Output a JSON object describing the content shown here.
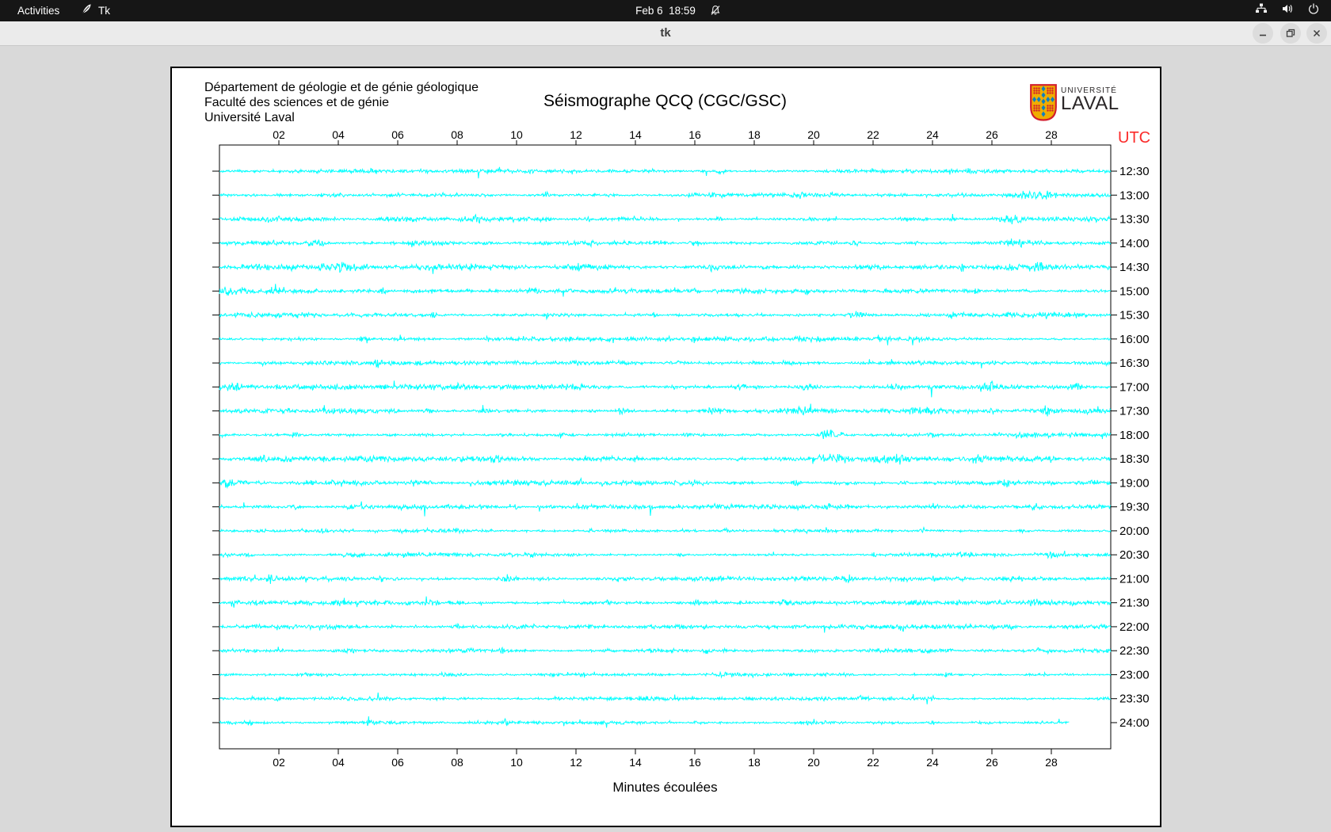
{
  "top_bar": {
    "activities": "Activities",
    "app_name": "Tk",
    "clock": "Feb 6  18:59"
  },
  "window": {
    "title": "tk"
  },
  "canvas": {
    "header_lines": [
      "Département de géologie et de génie géologique",
      "Faculté des sciences et de génie",
      "Université Laval"
    ],
    "title": "Séismographe QCQ (CGC/GSC)",
    "utc_label": "UTC",
    "x_axis_label": "Minutes écoulées",
    "logo": {
      "line1": "UNIVERSITÉ",
      "line2": "LAVAL"
    }
  },
  "colors": {
    "trace": "#00ffff",
    "axis": "#000000",
    "utc_red": "#fb2b2a",
    "canvas_bg": "#ffffff",
    "app_bg": "#d9d9d9"
  },
  "seismogram": {
    "type": "line",
    "x_ticks": [
      "02",
      "04",
      "06",
      "08",
      "10",
      "12",
      "14",
      "16",
      "18",
      "20",
      "22",
      "24",
      "26",
      "28"
    ],
    "x_range_minutes": [
      0,
      30
    ],
    "minutes_per_tick": 2,
    "traces": [
      {
        "utc": "12:30",
        "activity": 0.9,
        "end": 30,
        "events": [
          [
            5.2,
            5,
            0.08
          ],
          [
            9.4,
            4,
            0.06
          ],
          [
            13.1,
            3,
            0.06
          ],
          [
            16.9,
            5,
            0.1
          ],
          [
            20.4,
            3,
            0.06
          ],
          [
            25.3,
            6,
            0.12
          ],
          [
            28.9,
            3,
            0.1
          ]
        ]
      },
      {
        "utc": "13:00",
        "activity": 0.9,
        "end": 30,
        "events": [
          [
            3.4,
            3,
            0.08
          ],
          [
            11.0,
            4,
            0.08
          ],
          [
            16.5,
            3,
            0.06
          ],
          [
            19.6,
            3,
            0.06
          ],
          [
            23.0,
            3,
            0.08
          ],
          [
            27.6,
            6,
            0.45
          ]
        ]
      },
      {
        "utc": "13:30",
        "activity": 1.1,
        "end": 30,
        "events": [
          [
            1.6,
            4,
            0.1
          ],
          [
            6.2,
            4,
            0.55
          ],
          [
            8.6,
            4,
            0.1
          ],
          [
            12.4,
            4,
            0.08
          ],
          [
            16.8,
            3,
            0.08
          ],
          [
            19.9,
            4,
            0.1
          ],
          [
            23.0,
            3,
            0.1
          ],
          [
            26.6,
            5,
            0.3
          ]
        ]
      },
      {
        "utc": "14:00",
        "activity": 1.0,
        "end": 30,
        "events": [
          [
            3.3,
            5,
            0.2
          ],
          [
            6.5,
            3,
            0.1
          ],
          [
            9.0,
            4,
            0.1
          ],
          [
            12.5,
            3,
            0.08
          ],
          [
            16.0,
            4,
            0.1
          ],
          [
            21.4,
            4,
            0.1
          ],
          [
            24.3,
            3,
            0.08
          ],
          [
            26.9,
            6,
            0.22
          ]
        ]
      },
      {
        "utc": "14:30",
        "activity": 1.2,
        "end": 30,
        "events": [
          [
            1.2,
            3,
            0.1
          ],
          [
            4.1,
            5,
            0.3
          ],
          [
            8.0,
            3,
            0.1
          ],
          [
            12.2,
            5,
            0.5
          ],
          [
            16.6,
            4,
            0.2
          ],
          [
            19.5,
            3,
            0.1
          ],
          [
            22.0,
            4,
            0.2
          ],
          [
            25.0,
            3,
            0.1
          ],
          [
            27.6,
            5,
            0.2
          ]
        ]
      },
      {
        "utc": "15:00",
        "activity": 1.2,
        "end": 30,
        "events": [
          [
            0.5,
            6,
            0.35
          ],
          [
            1.7,
            5,
            0.2
          ],
          [
            5.5,
            3,
            0.1
          ],
          [
            10.6,
            4,
            0.15
          ],
          [
            13.4,
            3,
            0.1
          ],
          [
            16.0,
            4,
            0.1
          ],
          [
            19.8,
            3,
            0.1
          ],
          [
            22.5,
            3,
            0.1
          ],
          [
            25.4,
            4,
            0.15
          ]
        ]
      },
      {
        "utc": "15:30",
        "activity": 1.0,
        "end": 30,
        "events": [
          [
            2.0,
            3,
            0.1
          ],
          [
            7.2,
            3,
            0.08
          ],
          [
            11.0,
            3,
            0.08
          ],
          [
            14.6,
            4,
            0.1
          ],
          [
            18.2,
            3,
            0.08
          ],
          [
            21.4,
            6,
            0.15
          ],
          [
            24.6,
            4,
            0.1
          ],
          [
            27.8,
            4,
            0.1
          ]
        ]
      },
      {
        "utc": "16:00",
        "activity": 0.85,
        "end": 30,
        "events": [
          [
            4.8,
            4,
            0.1
          ],
          [
            9.0,
            3,
            0.06
          ],
          [
            16.0,
            3,
            0.08
          ],
          [
            20.2,
            3,
            0.06
          ],
          [
            23.5,
            4,
            0.1
          ]
        ]
      },
      {
        "utc": "16:30",
        "activity": 0.85,
        "end": 30,
        "events": [
          [
            1.5,
            3,
            0.08
          ],
          [
            5.3,
            6,
            0.1
          ],
          [
            12.0,
            3,
            0.08
          ],
          [
            15.5,
            3,
            0.06
          ],
          [
            19.0,
            3,
            0.08
          ],
          [
            22.6,
            3,
            0.06
          ],
          [
            26.0,
            3,
            0.08
          ]
        ]
      },
      {
        "utc": "17:00",
        "activity": 1.25,
        "end": 30,
        "events": [
          [
            0.4,
            6,
            0.3
          ],
          [
            3.8,
            4,
            0.15
          ],
          [
            8.0,
            3,
            0.1
          ],
          [
            12.0,
            3,
            0.1
          ],
          [
            15.2,
            3,
            0.1
          ],
          [
            17.5,
            4,
            0.15
          ],
          [
            19.8,
            5,
            0.2
          ],
          [
            22.8,
            4,
            0.15
          ],
          [
            25.9,
            6,
            0.3
          ],
          [
            28.8,
            4,
            0.2
          ]
        ]
      },
      {
        "utc": "17:30",
        "activity": 1.2,
        "end": 30,
        "events": [
          [
            0.8,
            4,
            0.1
          ],
          [
            3.5,
            6,
            0.12
          ],
          [
            7.0,
            3,
            0.1
          ],
          [
            10.5,
            3,
            0.1
          ],
          [
            13.5,
            4,
            0.1
          ],
          [
            16.5,
            3,
            0.1
          ],
          [
            19.5,
            4,
            0.28
          ],
          [
            23.5,
            5,
            0.3
          ],
          [
            26.0,
            4,
            0.15
          ],
          [
            27.9,
            7,
            0.14
          ]
        ]
      },
      {
        "utc": "18:00",
        "activity": 0.9,
        "end": 30,
        "events": [
          [
            2.5,
            3,
            0.1
          ],
          [
            7.0,
            3,
            0.08
          ],
          [
            11.5,
            3,
            0.08
          ],
          [
            15.8,
            3,
            0.1
          ],
          [
            20.5,
            6,
            0.3
          ],
          [
            24.0,
            3,
            0.1
          ],
          [
            27.0,
            3,
            0.1
          ]
        ]
      },
      {
        "utc": "18:30",
        "activity": 1.15,
        "end": 30,
        "events": [
          [
            1.5,
            3,
            0.1
          ],
          [
            5.0,
            4,
            0.15
          ],
          [
            9.3,
            5,
            0.12
          ],
          [
            14.0,
            4,
            0.1
          ],
          [
            17.5,
            3,
            0.1
          ],
          [
            20.6,
            8,
            0.5
          ],
          [
            22.7,
            8,
            0.55
          ],
          [
            25.5,
            4,
            0.15
          ],
          [
            28.0,
            3,
            0.1
          ]
        ]
      },
      {
        "utc": "19:00",
        "activity": 1.0,
        "end": 30,
        "events": [
          [
            0.3,
            7,
            0.14
          ],
          [
            3.0,
            3,
            0.1
          ],
          [
            6.5,
            3,
            0.1
          ],
          [
            9.8,
            4,
            0.1
          ],
          [
            12.2,
            4,
            0.1
          ],
          [
            16.0,
            3,
            0.1
          ],
          [
            19.4,
            4,
            0.1
          ],
          [
            23.0,
            3,
            0.08
          ],
          [
            26.5,
            3,
            0.08
          ]
        ]
      },
      {
        "utc": "19:30",
        "activity": 0.9,
        "end": 30,
        "events": [
          [
            2.5,
            3,
            0.1
          ],
          [
            6.0,
            3,
            0.08
          ],
          [
            10.0,
            3,
            0.08
          ],
          [
            14.5,
            11,
            0.05
          ],
          [
            16.8,
            5,
            0.1
          ],
          [
            20.5,
            3,
            0.08
          ],
          [
            24.0,
            3,
            0.08
          ],
          [
            27.5,
            3,
            0.1
          ]
        ]
      },
      {
        "utc": "20:00",
        "activity": 0.75,
        "end": 30,
        "events": [
          [
            3.5,
            4,
            0.1
          ],
          [
            8.0,
            3,
            0.06
          ],
          [
            12.5,
            3,
            0.06
          ],
          [
            17.0,
            3,
            0.06
          ],
          [
            20.5,
            3,
            0.06
          ],
          [
            23.7,
            4,
            0.08
          ],
          [
            27.0,
            3,
            0.06
          ]
        ]
      },
      {
        "utc": "20:30",
        "activity": 0.85,
        "end": 30,
        "events": [
          [
            1.0,
            4,
            0.1
          ],
          [
            4.7,
            4,
            0.1
          ],
          [
            8.5,
            3,
            0.08
          ],
          [
            12.0,
            3,
            0.1
          ],
          [
            15.5,
            3,
            0.08
          ],
          [
            18.6,
            3,
            0.1
          ],
          [
            22.0,
            3,
            0.08
          ],
          [
            25.2,
            4,
            0.1
          ],
          [
            28.0,
            3,
            0.08
          ]
        ]
      },
      {
        "utc": "21:00",
        "activity": 0.95,
        "end": 30,
        "events": [
          [
            1.7,
            4,
            0.1
          ],
          [
            5.5,
            3,
            0.1
          ],
          [
            9.7,
            5,
            0.22
          ],
          [
            13.5,
            3,
            0.1
          ],
          [
            17.0,
            3,
            0.08
          ],
          [
            21.2,
            4,
            0.1
          ],
          [
            24.0,
            3,
            0.08
          ],
          [
            26.6,
            4,
            0.14
          ]
        ]
      },
      {
        "utc": "21:30",
        "activity": 1.05,
        "end": 30,
        "events": [
          [
            0.5,
            5,
            0.1
          ],
          [
            4.0,
            4,
            0.1
          ],
          [
            8.0,
            3,
            0.1
          ],
          [
            13.0,
            4,
            0.1
          ],
          [
            16.0,
            3,
            0.08
          ],
          [
            19.0,
            4,
            0.1
          ],
          [
            23.4,
            4,
            0.15
          ],
          [
            27.4,
            5,
            0.15
          ]
        ]
      },
      {
        "utc": "22:00",
        "activity": 0.9,
        "end": 30,
        "events": [
          [
            2.0,
            3,
            0.1
          ],
          [
            8.0,
            5,
            0.14
          ],
          [
            12.5,
            3,
            0.1
          ],
          [
            15.5,
            3,
            0.08
          ],
          [
            19.4,
            4,
            0.1
          ],
          [
            23.0,
            3,
            0.1
          ],
          [
            26.6,
            4,
            0.1
          ]
        ]
      },
      {
        "utc": "22:30",
        "activity": 0.8,
        "end": 30,
        "events": [
          [
            4.4,
            4,
            0.15
          ],
          [
            9.5,
            3,
            0.1
          ],
          [
            13.0,
            3,
            0.08
          ],
          [
            16.4,
            3,
            0.1
          ],
          [
            20.0,
            2,
            0.08
          ],
          [
            24.5,
            3,
            0.1
          ],
          [
            27.5,
            3,
            0.08
          ]
        ]
      },
      {
        "utc": "23:00",
        "activity": 0.7,
        "end": 30,
        "events": [
          [
            3.0,
            2,
            0.08
          ],
          [
            7.5,
            2,
            0.08
          ],
          [
            12.2,
            4,
            0.08
          ],
          [
            17.0,
            2,
            0.08
          ],
          [
            21.0,
            2,
            0.06
          ],
          [
            24.5,
            3,
            0.08
          ],
          [
            27.8,
            2,
            0.08
          ]
        ]
      },
      {
        "utc": "23:30",
        "activity": 0.7,
        "end": 30,
        "events": [
          [
            2.0,
            2,
            0.08
          ],
          [
            6.5,
            2,
            0.08
          ],
          [
            11.3,
            3,
            0.1
          ],
          [
            14.5,
            2,
            0.08
          ],
          [
            17.9,
            3,
            0.08
          ],
          [
            21.5,
            2,
            0.08
          ],
          [
            24.0,
            3,
            0.08
          ]
        ]
      },
      {
        "utc": "24:00",
        "activity": 0.7,
        "end": 28.6,
        "events": [
          [
            1.0,
            3,
            0.1
          ],
          [
            5.0,
            2,
            0.08
          ],
          [
            9.6,
            3,
            0.08
          ],
          [
            12.1,
            3,
            0.08
          ],
          [
            16.0,
            2,
            0.08
          ],
          [
            20.0,
            2,
            0.06
          ],
          [
            24.0,
            2,
            0.06
          ]
        ]
      }
    ]
  }
}
